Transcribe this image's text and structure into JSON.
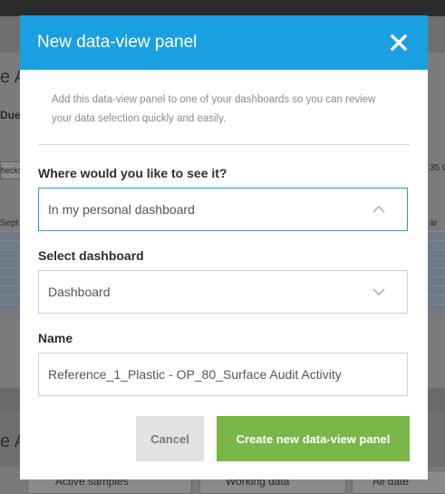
{
  "background": {
    "heading_fragment_top": "e A",
    "due_label": "Due:",
    "checks_label": "hecks",
    "month_left": "Sept",
    "month_right": "ar",
    "number_right": "35 C",
    "heading_fragment_bottom": "e A",
    "filters": [
      "Active samples",
      "Working data",
      "All date"
    ]
  },
  "modal": {
    "title": "New data-view panel",
    "description": "Add this data-view panel to one of your dashboards so you can review your data selection quickly and easily.",
    "location_label": "Where would you like to see it?",
    "location_value": "In my personal dashboard",
    "dashboard_label": "Select dashboard",
    "dashboard_value": "Dashboard",
    "name_label": "Name",
    "name_value": "Reference_1_Plastic - OP_80_Surface Audit Activity",
    "cancel_label": "Cancel",
    "create_label": "Create new data-view panel"
  },
  "colors": {
    "header": "#1a9fe0",
    "primary_button": "#7ab648",
    "cancel_button": "#e2e2e2",
    "active_border": "#1a9fe0"
  },
  "icons": {
    "close": "close-icon",
    "select_open": "chevron-up-icon",
    "select_closed": "chevron-down-icon"
  }
}
